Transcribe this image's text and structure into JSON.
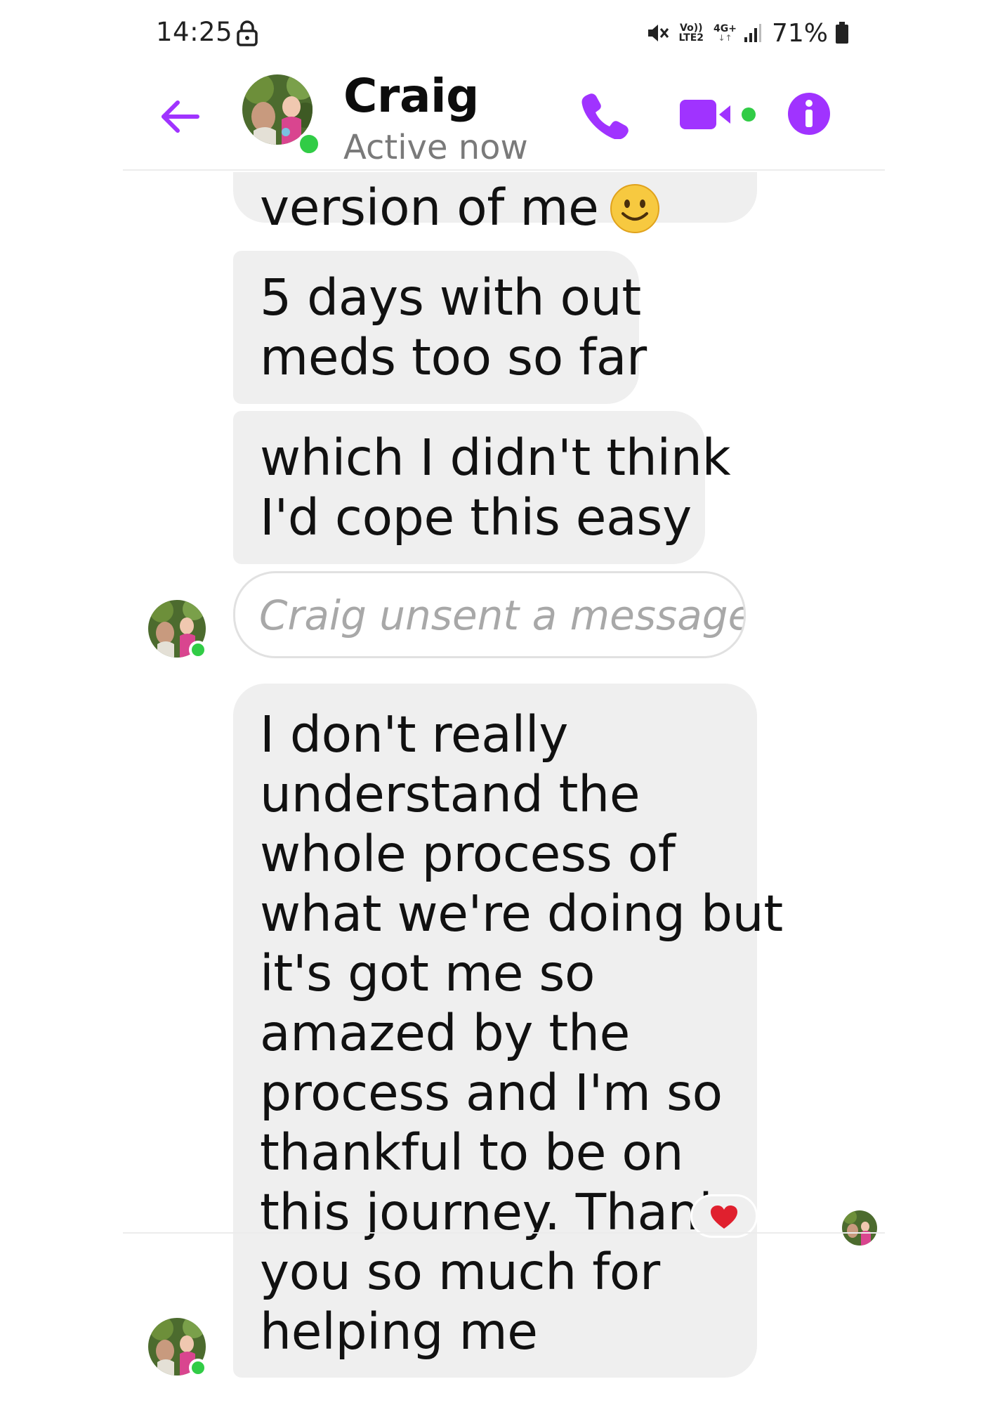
{
  "status_bar": {
    "time": "14:25",
    "network_top": "Vo))",
    "network_bottom": "LTE2",
    "data_type": "4G+",
    "data_arrows": "↓↑",
    "battery_percent": "71%"
  },
  "header": {
    "contact_name": "Craig",
    "presence": "Active now"
  },
  "messages": [
    {
      "lines": [
        "version of me"
      ],
      "emoji": "smile-emoji"
    },
    {
      "lines": [
        "5 days with out",
        "meds too so far"
      ]
    },
    {
      "lines": [
        "which I didn't think",
        "I'd cope this easy"
      ]
    },
    {
      "unsent_notice": "Craig unsent a message"
    },
    {
      "lines": [
        "I don't really",
        "understand the",
        "whole process of",
        "what we're doing but",
        "it's got me so",
        "amazed by the",
        "process and I'm so",
        "thankful to be on",
        "this journey. Thank",
        "you so much for",
        "helping me"
      ]
    }
  ],
  "reaction": "heart-icon",
  "colors": {
    "accent": "#a033ff",
    "online": "#31cc46",
    "bubble": "#efefef",
    "heart": "#e0202e"
  }
}
